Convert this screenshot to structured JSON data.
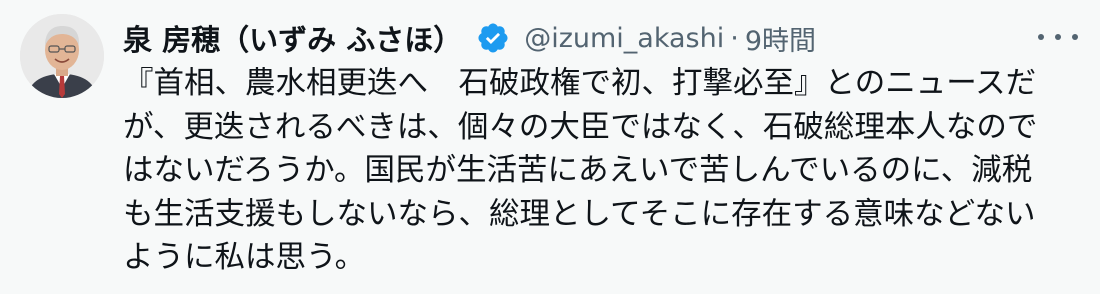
{
  "author": {
    "display_name": "泉 房穂（いずみ ふさほ）",
    "handle": "@izumi_akashi",
    "separator": "·",
    "timestamp": "9時間",
    "avatar_icon": "avatar-photo-icon",
    "verified_icon": "verified-badge-icon"
  },
  "tweet": {
    "lines": [
      "『首相、農水相更迭へ　石破政権で初、打撃必至』とのニュースだ",
      "が、更迭されるべきは、個々の大臣ではなく、石破総理本人なので",
      "はないだろうか。国民が生活苦にあえいで苦しんでいるのに、減税",
      "も生活支援もしないなら、総理としてそこに存在する意味などない",
      "ように私は思う。"
    ]
  },
  "icons": {
    "more": "more-options-icon"
  },
  "colors": {
    "background": "#f7f9f9",
    "text": "#0f1419",
    "secondary": "#536471",
    "verified": "#1d9bf0"
  }
}
